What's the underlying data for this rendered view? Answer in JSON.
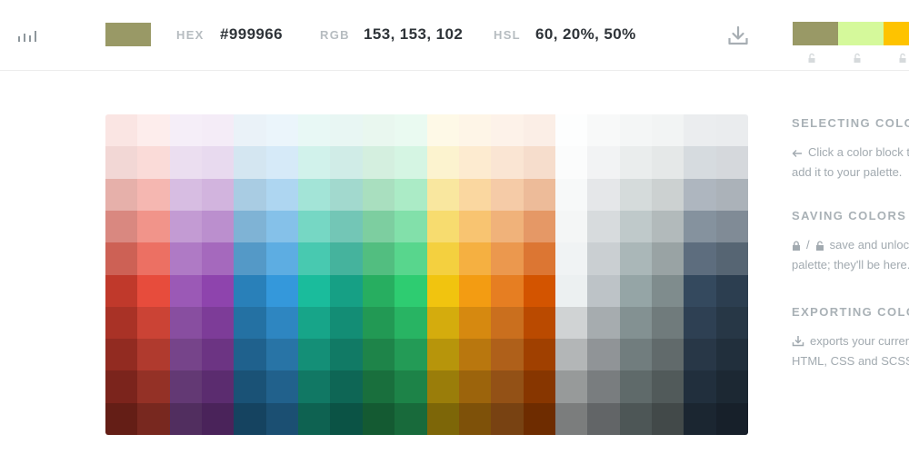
{
  "toolbar": {
    "current_color_hex": "#999966",
    "hex_label": "HEX",
    "hex_value": "#999966",
    "rgb_label": "RGB",
    "rgb_value": "153, 153, 102",
    "hsl_label": "HSL",
    "hsl_value": "60, 20%, 50%",
    "menu_icon": "bar-chart-icon",
    "download_icon": "download-icon"
  },
  "palette": {
    "swatches": [
      "#999966",
      "#d5f99b",
      "#fec300"
    ],
    "lock_icon": "unlock-icon"
  },
  "grid": {
    "columns": [
      [
        "#fae5e3",
        "#f2d7d5",
        "#e6b0aa",
        "#d98880",
        "#cd6155",
        "#c0392b",
        "#a93226",
        "#922b21",
        "#7b241c",
        "#641e16"
      ],
      [
        "#fdedec",
        "#fadbd8",
        "#f5b7b1",
        "#f1948a",
        "#ec7063",
        "#e74c3c",
        "#cb4335",
        "#b03a2e",
        "#943126",
        "#78281f"
      ],
      [
        "#f5eef8",
        "#ebdef0",
        "#d7bde2",
        "#c39bd3",
        "#af7ac5",
        "#9b59b6",
        "#884ea0",
        "#76448a",
        "#633974",
        "#512e5f"
      ],
      [
        "#f4ecf7",
        "#e8daef",
        "#d2b4de",
        "#bb8fce",
        "#a569bd",
        "#8e44ad",
        "#7d3c98",
        "#6c3483",
        "#5b2c6f",
        "#4a235a"
      ],
      [
        "#eaf2f8",
        "#d4e6f1",
        "#a9cce3",
        "#7fb3d5",
        "#5499c7",
        "#2980b9",
        "#2471a3",
        "#1f618d",
        "#1a5276",
        "#154360"
      ],
      [
        "#ebf5fb",
        "#d6eaf8",
        "#aed6f1",
        "#85c1e9",
        "#5dade2",
        "#3498db",
        "#2e86c1",
        "#2874a6",
        "#21618c",
        "#1b4f72"
      ],
      [
        "#e8f8f5",
        "#d1f2eb",
        "#a3e4d7",
        "#76d7c4",
        "#48c9b0",
        "#1abc9c",
        "#17a589",
        "#148f77",
        "#117864",
        "#0e6251"
      ],
      [
        "#e8f6f3",
        "#d0ece7",
        "#a2d9ce",
        "#73c6b6",
        "#45b39d",
        "#16a085",
        "#138d75",
        "#117a65",
        "#0e6655",
        "#0b5345"
      ],
      [
        "#e9f7ef",
        "#d4efdf",
        "#a9dfbf",
        "#7dcea0",
        "#52be80",
        "#27ae60",
        "#229954",
        "#1e8449",
        "#196f3d",
        "#145a32"
      ],
      [
        "#eafaf1",
        "#d5f5e3",
        "#abebc6",
        "#82e0aa",
        "#58d68d",
        "#2ecc71",
        "#28b463",
        "#239b56",
        "#1d8348",
        "#186a3b"
      ],
      [
        "#fef9e7",
        "#fcf3cf",
        "#f9e79f",
        "#f7dc6f",
        "#f4d03f",
        "#f1c40f",
        "#d4ac0d",
        "#b7950b",
        "#9a7d0a",
        "#7d6608"
      ],
      [
        "#fef5e7",
        "#fdebd0",
        "#fad7a0",
        "#f8c471",
        "#f5b041",
        "#f39c12",
        "#d68910",
        "#b9770e",
        "#9c640c",
        "#7e5109"
      ],
      [
        "#fdf2e9",
        "#fae5d3",
        "#f5cba7",
        "#f0b27a",
        "#eb984e",
        "#e67e22",
        "#ca6f1e",
        "#af601a",
        "#935116",
        "#784212"
      ],
      [
        "#fbeee6",
        "#f6ddcc",
        "#edbb99",
        "#e59866",
        "#dc7633",
        "#d35400",
        "#ba4a00",
        "#a04000",
        "#873600",
        "#6e2c00"
      ],
      [
        "#fdfefe",
        "#fbfcfc",
        "#f7f9f9",
        "#f4f6f6",
        "#f0f3f4",
        "#ecf0f1",
        "#d0d3d4",
        "#b3b6b7",
        "#979a9a",
        "#7b7d7d"
      ],
      [
        "#f8f9f9",
        "#f2f3f4",
        "#e5e7e9",
        "#d7dbdd",
        "#cacfd2",
        "#bdc3c7",
        "#a6acaf",
        "#909497",
        "#797d7f",
        "#626567"
      ],
      [
        "#f4f6f6",
        "#eaeded",
        "#d5dbdb",
        "#bfc9ca",
        "#aab7b8",
        "#95a5a6",
        "#839192",
        "#717d7e",
        "#5f6a6a",
        "#4d5656"
      ],
      [
        "#f2f4f4",
        "#e5e8e8",
        "#ccd1d1",
        "#b2babb",
        "#99a3a4",
        "#7f8c8d",
        "#707b7c",
        "#616a6b",
        "#515a5a",
        "#424949"
      ],
      [
        "#ebedef",
        "#d6dbdf",
        "#aeb6bf",
        "#85929e",
        "#5d6d7e",
        "#34495e",
        "#2e4053",
        "#283747",
        "#212f3d",
        "#1b2631"
      ],
      [
        "#eaecee",
        "#d5d8dc",
        "#abb2b9",
        "#808b96",
        "#566573",
        "#2c3e50",
        "#273746",
        "#212f3c",
        "#1c2833",
        "#17202a"
      ]
    ]
  },
  "help": {
    "selecting_title": "SELECTING COLORS",
    "selecting_text_1": "Click a color block to",
    "selecting_text_2": "add it to your palette.",
    "saving_title": "SAVING COLORS",
    "saving_text_1": "save and unlock the",
    "saving_text_2": "palette; they'll be here.",
    "exporting_title": "EXPORTING COLORS",
    "exporting_text_1": "exports your current",
    "exporting_text_2": "HTML, CSS and SCSS",
    "arrow_icon": "arrow-left-icon",
    "lock_icon": "lock-icon",
    "unlock_icon": "unlock-icon",
    "download_icon": "download-icon"
  }
}
